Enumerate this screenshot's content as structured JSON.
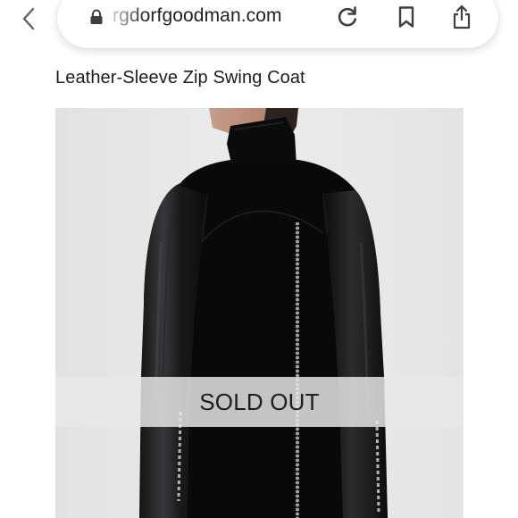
{
  "browser": {
    "url": "rgdorfgoodman.com",
    "icons": {
      "back": "chevron-left-icon",
      "lock": "lock-icon",
      "reload": "reload-icon",
      "bookmark": "bookmark-icon",
      "share": "share-icon"
    }
  },
  "product": {
    "title": "Leather-Sleeve Zip Swing Coat",
    "image_alt": "Back view of model wearing black coat with leather sleeves and center back zipper",
    "status": "SOLD OUT"
  },
  "colors": {
    "image_background": "#ededed",
    "coat": "#0b0b0c",
    "overlay": "#e8e8e8"
  }
}
